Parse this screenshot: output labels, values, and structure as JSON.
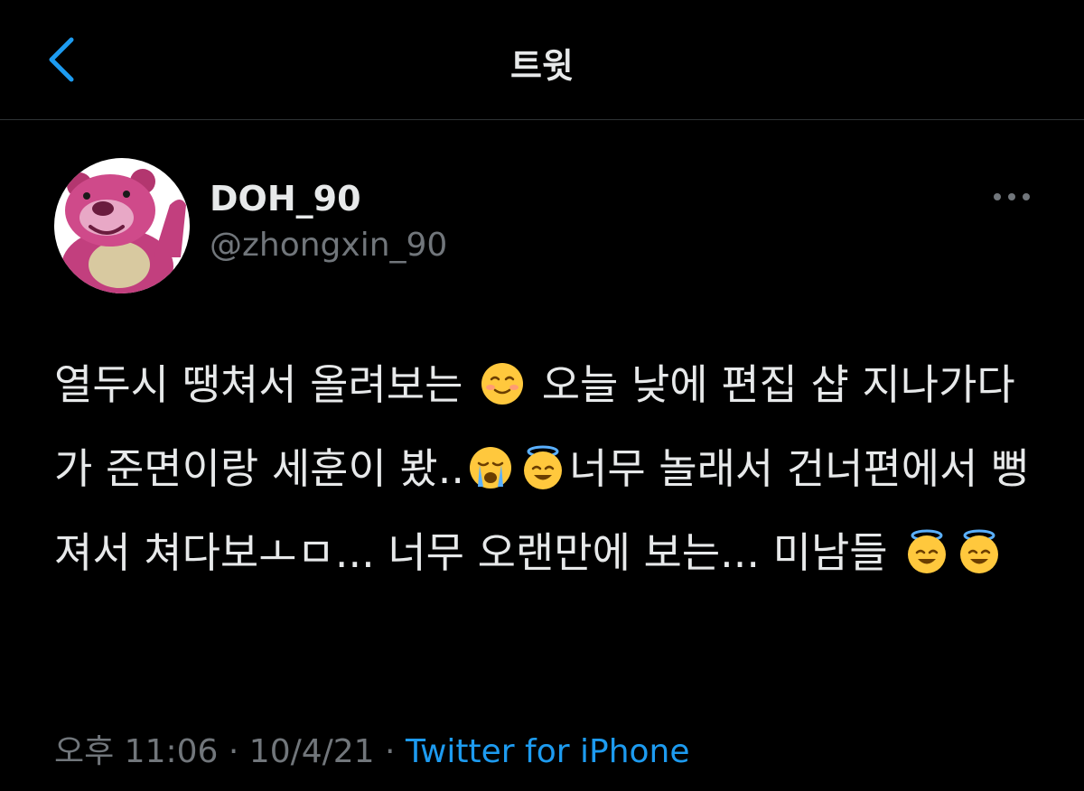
{
  "colors": {
    "background": "#000000",
    "text": "#e7e9ea",
    "secondary_text": "#71767b",
    "accent": "#1d9bf0",
    "divider": "#2f3336"
  },
  "nav": {
    "back_icon": "chevron-left-icon",
    "title": "트윗"
  },
  "author": {
    "display_name": "DOH_90",
    "handle": "@zhongxin_90",
    "avatar_icon": "pink-bear-avatar"
  },
  "more_icon": "more-horizontal-icon",
  "tweet": {
    "segments": {
      "s1": "열두시 땡쳐서 올려보는",
      "s2": "오늘 낮에 편집 샵 지나가다가 준면이랑 세훈이 봤..",
      "s3": "너무 놀래서 건너편에서 뻥져서 쳐다보ㅗㅁ... 너무 오랜만에 보는... 미남들"
    },
    "emojis": {
      "e1": "smiling-face-icon",
      "e2": "crying-face-icon",
      "e3": "halo-face-icon",
      "e4": "halo-face-icon",
      "e5": "halo-face-icon"
    }
  },
  "meta": {
    "time": "오후 11:06",
    "separator": "·",
    "date": "10/4/21",
    "source": "Twitter for iPhone"
  }
}
